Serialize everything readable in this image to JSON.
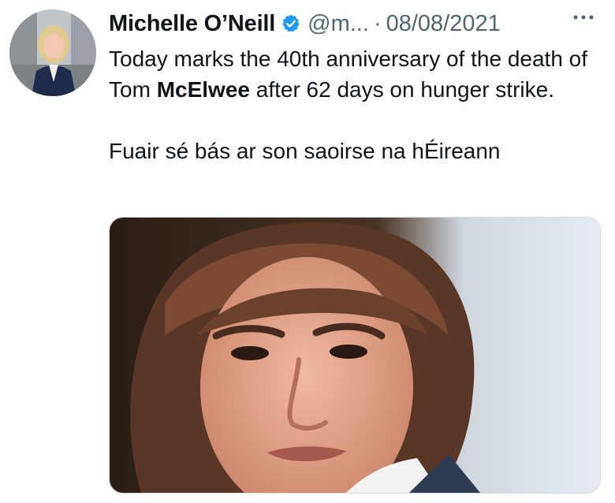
{
  "tweet": {
    "author": {
      "display_name": "Michelle O’Neill",
      "handle": "@m...",
      "verified": true,
      "avatar_icon": "profile-photo"
    },
    "separator": "·",
    "date": "08/08/2021",
    "more_icon": "ellipsis-icon",
    "text": {
      "line1_prefix": "Today marks the 40th anniversary of the death of Tom ",
      "line1_bold": "McElwee",
      "line1_suffix": " after 62 days on hunger strike.",
      "line2": "Fuair sé bás ar son saoirse na hÉireann"
    },
    "media": {
      "type": "photo",
      "icon": "portrait-photo"
    }
  },
  "colors": {
    "text_primary": "#0f1419",
    "text_secondary": "#536471",
    "verified_blue": "#1d9bf0",
    "border": "#cfd9de"
  }
}
